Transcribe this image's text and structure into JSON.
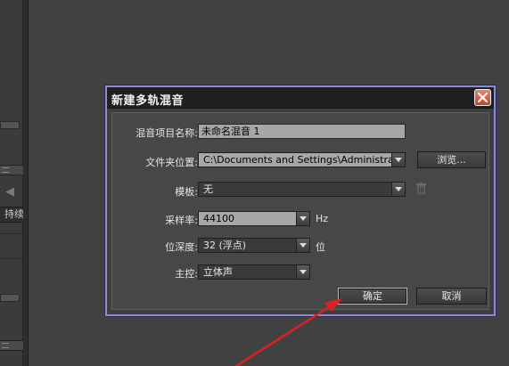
{
  "background": {
    "side_tab_label": "持续"
  },
  "dialog": {
    "title": "新建多轨混音",
    "fields": {
      "name_label": "混音项目名称:",
      "name_value": "未命名混音 1",
      "folder_label": "文件夹位置:",
      "folder_value": "C:\\Documents and Settings\\Administrator...",
      "browse_label": "浏览...",
      "template_label": "模板:",
      "template_value": "无",
      "sample_rate_label": "采样率:",
      "sample_rate_value": "44100",
      "sample_rate_unit": "Hz",
      "bit_depth_label": "位深度:",
      "bit_depth_value": "32 (浮点)",
      "bit_depth_unit": "位",
      "master_label": "主控:",
      "master_value": "立体声"
    },
    "ok_label": "确定",
    "cancel_label": "取消"
  },
  "colors": {
    "dialog_border": "#8d8bd6",
    "annotation_arrow": "#e02020",
    "close_button": "#c4432a"
  }
}
